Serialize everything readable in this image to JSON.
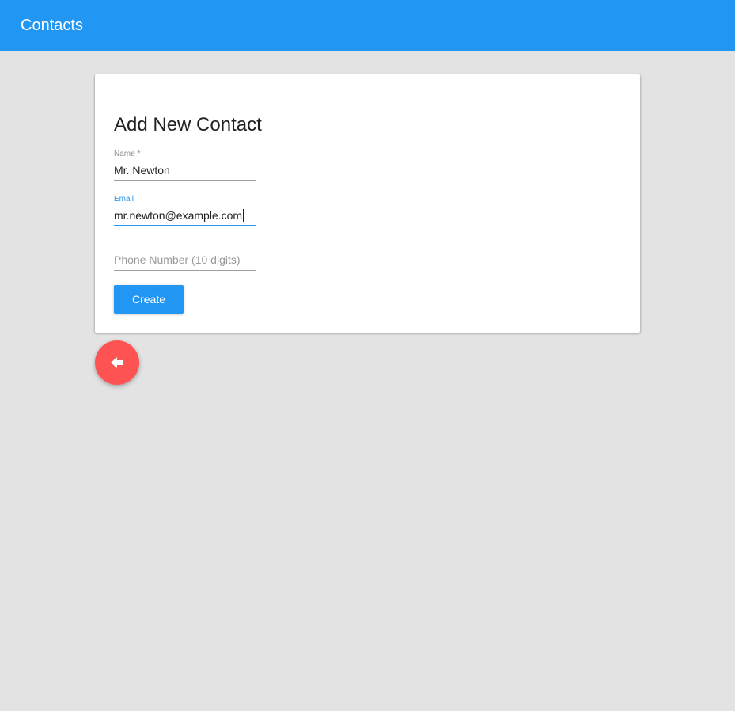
{
  "appbar": {
    "title": "Contacts",
    "color": "#2196f3"
  },
  "form": {
    "title": "Add New Contact",
    "name": {
      "label": "Name *",
      "value": "Mr. Newton"
    },
    "email": {
      "label": "Email",
      "value": "mr.newton@example.com",
      "focused": true
    },
    "phone": {
      "placeholder": "Phone Number (10 digits)",
      "value": ""
    },
    "create_label": "Create"
  },
  "fab": {
    "icon": "back-arrow-icon",
    "color": "#ff5252"
  },
  "colors": {
    "accent": "#2196f3",
    "background": "#e3e3e3"
  }
}
